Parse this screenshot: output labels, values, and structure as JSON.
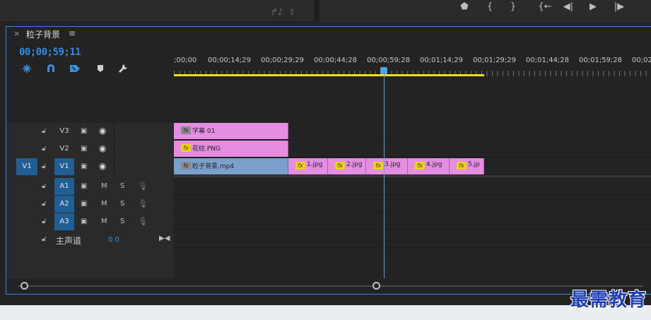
{
  "top_toolbar": {
    "left_buttons": [
      "↱♪",
      "⇪"
    ],
    "right_buttons": [
      "⬟",
      "{",
      "}",
      "{←",
      "◀|",
      "▶",
      "|▶"
    ]
  },
  "panel": {
    "close_glyph": "×",
    "sequence_name": "粒子背景",
    "menu_glyph": "≡",
    "timecode": "00;00;59;11",
    "tools": [
      "snap-icon",
      "magnet-icon",
      "marker-link-icon",
      "add-marker-icon",
      "wrench-icon"
    ]
  },
  "ruler": {
    "labels": [
      ";00;00",
      "00;00;14;29",
      "00;00;29;29",
      "00;00;44;28",
      "00;00;59;28",
      "00;01;14;29",
      "00;01;29;29",
      "00;01;44;28",
      "00;01;59;28",
      "00;02"
    ]
  },
  "tracks": {
    "video": [
      {
        "name": "V3",
        "source": ""
      },
      {
        "name": "V2",
        "source": ""
      },
      {
        "name": "V1",
        "source": "V1"
      }
    ],
    "audio": [
      {
        "name": "A1",
        "mute": "M",
        "solo": "S"
      },
      {
        "name": "A2",
        "mute": "M",
        "solo": "S"
      },
      {
        "name": "A3",
        "mute": "M",
        "solo": "S"
      }
    ],
    "master": {
      "label": "主声道",
      "value": "0.0"
    }
  },
  "clips": {
    "v3": [
      {
        "label": "字幕 01",
        "fx": "fx"
      }
    ],
    "v2": [
      {
        "label": "花纹.PNG",
        "fx": "fx"
      }
    ],
    "v1": [
      {
        "label": "粒子背景.mp4",
        "fx": "fx"
      },
      {
        "label": "1.jpg",
        "fx": "fx"
      },
      {
        "label": "2.jpg",
        "fx": "fx"
      },
      {
        "label": "3.jpg",
        "fx": "fx"
      },
      {
        "label": "4.jpg",
        "fx": "fx"
      },
      {
        "label": "5.jp",
        "fx": "fx"
      }
    ]
  },
  "watermark": "最需教育",
  "colors": {
    "accent": "#2d8ceb",
    "pink_clip": "#e58ee1",
    "blue_clip": "#7aa0cc",
    "work_area": "#f2e10a"
  }
}
